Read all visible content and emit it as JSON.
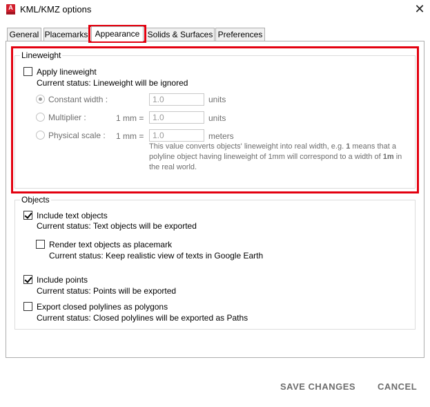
{
  "window": {
    "title": "KML/KMZ options",
    "app_icon_letter": "A"
  },
  "tabs": [
    {
      "label": "General"
    },
    {
      "label": "Placemarks"
    },
    {
      "label": "Appearance",
      "active": true
    },
    {
      "label": "Solids & Surfaces"
    },
    {
      "label": "Preferences"
    }
  ],
  "lineweight": {
    "title": "Lineweight",
    "apply_label": "Apply lineweight",
    "apply_checked": false,
    "status": "Current status: Lineweight will be ignored",
    "constant_width": {
      "label": "Constant width :",
      "value": "1.0",
      "unit": "units",
      "selected": true
    },
    "multiplier": {
      "label": "Multiplier :",
      "prefix": "1 mm =",
      "value": "1.0",
      "unit": "units",
      "selected": false
    },
    "physical_scale": {
      "label": "Physical scale :",
      "prefix": "1 mm =",
      "value": "1.0",
      "unit": "meters",
      "selected": false
    },
    "note": {
      "part1": "This value converts objects' lineweight into real width, e.g. ",
      "bold1": "1",
      "part2": " means that a polyline object having lineweight of 1mm will correspond to a width of ",
      "bold2": "1m",
      "part3": " in the real world."
    }
  },
  "objects": {
    "title": "Objects",
    "include_text": {
      "label": "Include text objects",
      "checked": true,
      "status": "Current status: Text objects will be exported"
    },
    "render_placemark": {
      "label": "Render text objects as placemark",
      "checked": false,
      "status": "Current status: Keep realistic view of texts in Google Earth"
    },
    "include_points": {
      "label": "Include points",
      "checked": true,
      "status": "Current status: Points will be exported"
    },
    "closed_polylines": {
      "label": "Export closed polylines as polygons",
      "checked": false,
      "status": "Current status: Closed polylines will be exported as Paths"
    }
  },
  "footer": {
    "save_label": "SAVE CHANGES",
    "cancel_label": "CANCEL"
  },
  "colors": {
    "highlight": "#e3000f",
    "app_icon": "#d21f2e"
  }
}
